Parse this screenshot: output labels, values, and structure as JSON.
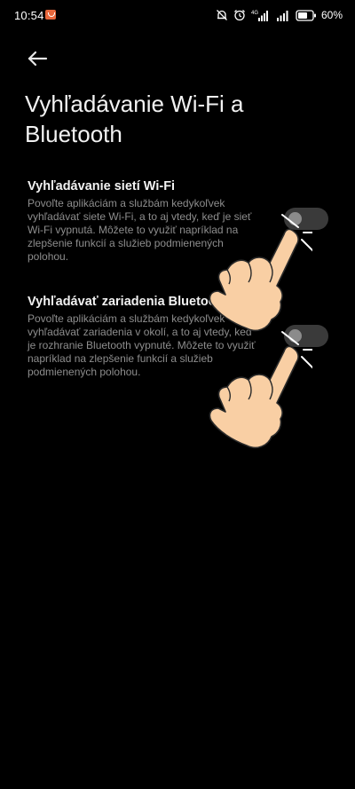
{
  "status_bar": {
    "time": "10:54",
    "battery_percent": "60",
    "network_label": "4G",
    "icons": [
      "orange-notification-icon",
      "alarm-off-icon",
      "alarm-clock-icon",
      "signal-icon",
      "signal-icon",
      "battery-icon"
    ]
  },
  "header": {
    "back_icon": "arrow-left-icon",
    "title": "Vyhľadávanie Wi-Fi a Bluetooth"
  },
  "settings": [
    {
      "title": "Vyhľadávanie sietí Wi-Fi",
      "description": "Povoľte aplikáciám a službám kedykoľvek vyhľadávať siete Wi-Fi, a to aj vtedy, keď je sieť Wi-Fi vypnutá. Môžete to využiť napríklad na zlepšenie funkcií a služieb podmienených polohou.",
      "enabled": false
    },
    {
      "title": "Vyhľadávať zariadenia Bluetooth",
      "description": "Povoľte aplikáciám a službám kedykoľvek vyhľadávať zariadenia v okolí, a to aj vtedy, keď je rozhranie Bluetooth vypnuté. Môžete to využiť napríklad na zlepšenie funkcií a služieb podmienených polohou.",
      "enabled": false
    }
  ],
  "overlay": {
    "hand_icon": "tap-hand-icon",
    "hand_color": "#f9cfa4"
  },
  "colors": {
    "background": "#000000",
    "title_text": "#f2f2f2",
    "description_text": "#8d8d8d",
    "toggle_track": "#3a3a3a",
    "toggle_knob": "#8b8b8b"
  }
}
